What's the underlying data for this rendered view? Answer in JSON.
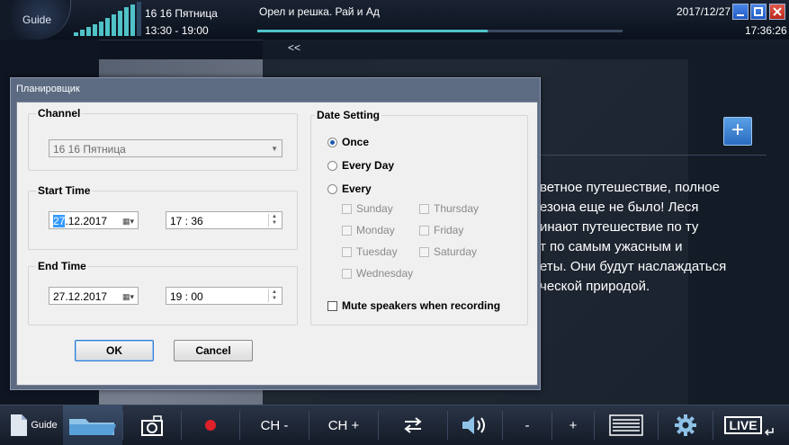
{
  "topbar": {
    "guide_label": "Guide",
    "channel_name": "16 16 Пятница",
    "channel_time": "13:30 - 19:00",
    "program_title": "Орел и решка. Рай и Ад",
    "progress": 0.63,
    "date": "2017/12/27",
    "clock": "17:36:26"
  },
  "background": {
    "collapse_label": "<<",
    "add_label": "+",
    "description": "ветное путешествие, полное\nезона еще не было! Леся\nинают путешествие по ту\nт по самым ужасным и\nеты. Они будут наслаждаться\nческой природой."
  },
  "dialog": {
    "title": "Планировщик",
    "channel": {
      "group_label": "Channel",
      "selected": "16 16 Пятница"
    },
    "start": {
      "group_label": "Start Time",
      "date_selected": "27",
      "date_rest": ".12.2017",
      "time": "17 : 36"
    },
    "end": {
      "group_label": "End Time",
      "date": "27.12.2017",
      "time": "19 : 00"
    },
    "date_setting": {
      "group_label": "Date Setting",
      "options": [
        "Once",
        "Every Day",
        "Every"
      ],
      "selected_option": "Once",
      "days": [
        "Sunday",
        "Thursday",
        "Monday",
        "Friday",
        "Tuesday",
        "Saturday",
        "Wednesday"
      ],
      "mute_label": "Mute speakers when recording"
    },
    "ok_label": "OK",
    "cancel_label": "Cancel"
  },
  "bottombar": {
    "guide_label": "Guide",
    "ch_minus": "CH -",
    "ch_plus": "CH +",
    "vol_minus": "-",
    "vol_plus": "+",
    "live_label": "LIVE"
  },
  "colors": {
    "accent": "#4fc3c8",
    "record": "#e0202a",
    "dialog_frame": "#5c6b82"
  }
}
